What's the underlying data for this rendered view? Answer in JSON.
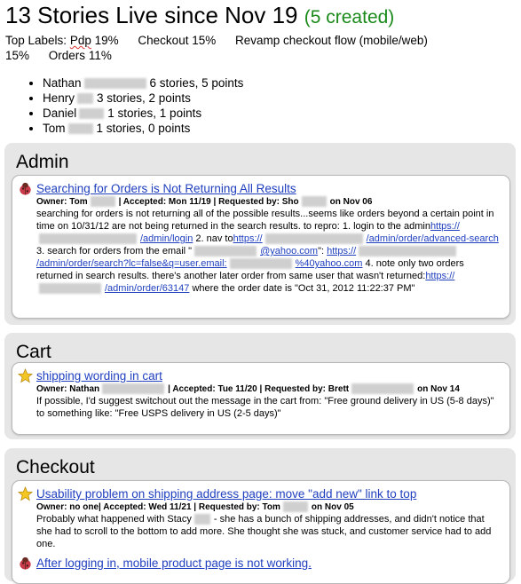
{
  "header": {
    "title": "13 Stories Live since Nov 19",
    "created": "(5 created)",
    "top_labels_prefix": "Top Labels:",
    "labels": [
      {
        "name": "Pdp",
        "pct": "19%"
      },
      {
        "name": "Checkout",
        "pct": "15%"
      },
      {
        "name": "Revamp checkout flow (mobile/web)",
        "pct": "15%"
      },
      {
        "name": "Orders",
        "pct": "11%"
      }
    ]
  },
  "people": [
    {
      "name": "Nathan",
      "summary": "6 stories, 5 points"
    },
    {
      "name": "Henry",
      "summary": "3 stories, 2 points"
    },
    {
      "name": "Daniel",
      "summary": "1 stories, 1 points"
    },
    {
      "name": "Tom",
      "summary": "1 stories, 0 points"
    }
  ],
  "sections": [
    {
      "name": "Admin",
      "stories": [
        {
          "icon": "bug-icon",
          "title": "Searching for Orders is Not Returning All Results",
          "owner": "Owner: Tom",
          "accepted": "| Accepted: Mon 11/19 | Requested by: Sho",
          "requested_date": "on Nov 06",
          "desc_1": "searching for orders is not returning all of the possible results...seems like orders beyond a certain point in time on 10/31/12 are not being returned in the search results. to repro: 1. login to the admin",
          "link_1": "https://",
          "link_1b": "/admin/login",
          "desc_2": " 2. nav to",
          "link_2": "https://",
          "link_2b": "/admin/order/advanced-search",
          "desc_3": " 3. search for orders from the email \"",
          "email_1": "@yahoo.com",
          "desc_4": "\": ",
          "link_3": "https://",
          "link_3b": "/admin/order/search?lc=false&q=user.email:",
          "link_3c": "%40yahoo.com",
          "desc_5": " 4. note only two orders returned in search results. there's another later order from same user that wasn't returned:",
          "link_4": "https://",
          "link_4b": "/admin/order/63147",
          "desc_6": " where the order date is \"Oct 31, 2012 11:22:37 PM\""
        }
      ]
    },
    {
      "name": "Cart",
      "stories": [
        {
          "icon": "star-icon",
          "title": "shipping wording in cart",
          "owner": "Owner: Nathan",
          "accepted": "| Accepted: Tue 11/20 | Requested by: Brett",
          "requested_date": "on Nov 14",
          "desc": "If possible, I'd suggest switchout out the message in the cart from: \"Free ground delivery in US (5-8 days)\" to something like: \"Free USPS delivery in US (2-5 days)\""
        }
      ]
    },
    {
      "name": "Checkout",
      "stories": [
        {
          "icon": "star-icon",
          "title": "Usability problem on shipping address page: move \"add new\" link to top",
          "owner": "Owner: no one",
          "accepted": "| Accepted: Wed 11/21 | Requested by: Tom",
          "requested_date": "on Nov 05",
          "desc_a": "Probably what happened with Stacy",
          "desc_b": "- she has a bunch of shipping addresses, and didn't notice that she had to scroll to the bottom to add more. She thought she was stuck, and customer service had to add one."
        },
        {
          "icon": "bug-icon",
          "title": "After logging in, mobile product page is not working."
        }
      ]
    }
  ],
  "colors": {
    "created": "#1a8a1a",
    "link": "#1f3fbf",
    "section_bg": "#e6e6e6"
  }
}
